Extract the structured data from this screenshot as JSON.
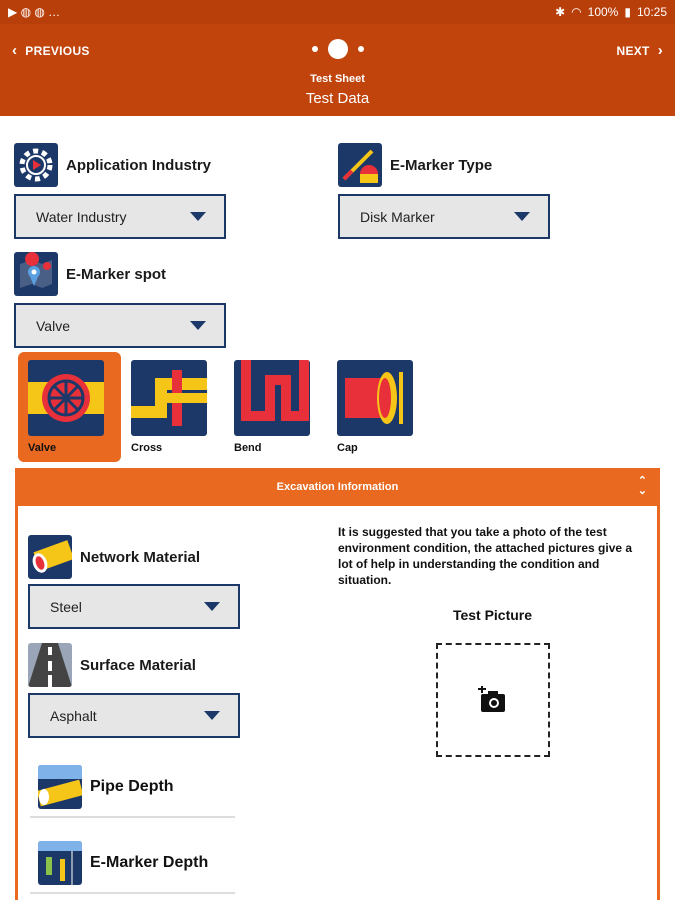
{
  "status_bar": {
    "time": "10:25",
    "battery": "100%",
    "left_icons": "▶ ◍ ◍ …"
  },
  "header": {
    "prev_label": "PREVIOUS",
    "next_label": "NEXT",
    "subtitle": "Test Sheet",
    "title": "Test Data"
  },
  "application_industry": {
    "label": "Application Industry",
    "value": "Water Industry"
  },
  "emarker_type": {
    "label": "E-Marker Type",
    "value": "Disk Marker"
  },
  "emarker_spot": {
    "label": "E-Marker spot",
    "value": "Valve",
    "options": [
      {
        "label": "Valve",
        "selected": true
      },
      {
        "label": "Cross",
        "selected": false
      },
      {
        "label": "Bend",
        "selected": false
      },
      {
        "label": "Cap",
        "selected": false
      }
    ]
  },
  "excavation": {
    "title": "Excavation Information",
    "hint": "It is suggested that you take a photo of the test environment condition, the attached pictures give a lot of help in understanding the condition and situation.",
    "picture_label": "Test Picture",
    "network_material": {
      "label": "Network Material",
      "value": "Steel"
    },
    "surface_material": {
      "label": "Surface Material",
      "value": "Asphalt"
    },
    "pipe_depth_label": "Pipe Depth",
    "emarker_depth_label": "E-Marker Depth"
  },
  "colors": {
    "header": "#c0440c",
    "accent": "#e8691f",
    "navy": "#1c3868",
    "yellow": "#f5c518",
    "red": "#e8303a"
  }
}
